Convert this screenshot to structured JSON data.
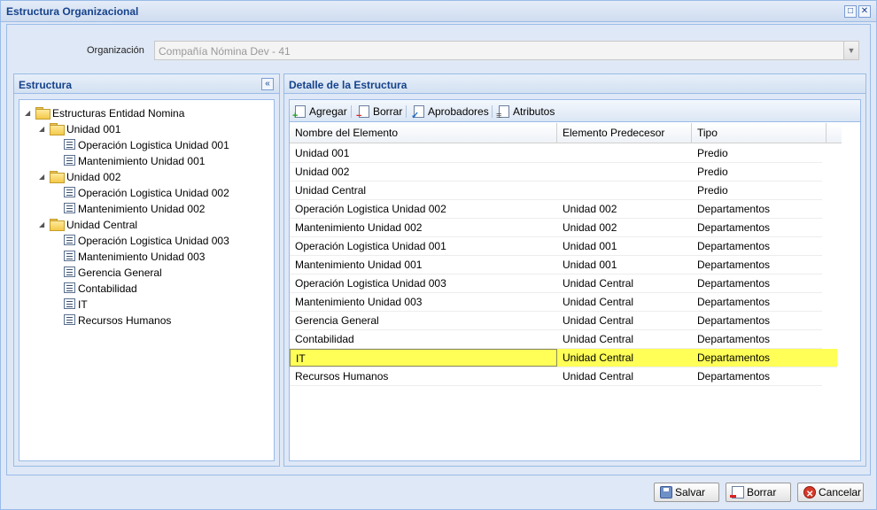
{
  "window": {
    "title": "Estructura Organizacional",
    "maximize_glyph": "□",
    "close_glyph": "✕"
  },
  "organization": {
    "label": "Organización",
    "value": "Compañía Nómina Dev - 41"
  },
  "left_panel": {
    "title": "Estructura",
    "collapse_glyph": "«",
    "tree": [
      {
        "label": "Estructuras Entidad Nomina",
        "level": 0,
        "type": "folder"
      },
      {
        "label": "Unidad 001",
        "level": 1,
        "type": "folder"
      },
      {
        "label": "Operación Logistica Unidad 001",
        "level": 2,
        "type": "leaf"
      },
      {
        "label": "Mantenimiento Unidad 001",
        "level": 2,
        "type": "leaf"
      },
      {
        "label": "Unidad 002",
        "level": 1,
        "type": "folder"
      },
      {
        "label": "Operación Logistica Unidad 002",
        "level": 2,
        "type": "leaf"
      },
      {
        "label": "Mantenimiento Unidad 002",
        "level": 2,
        "type": "leaf"
      },
      {
        "label": "Unidad Central",
        "level": 1,
        "type": "folder"
      },
      {
        "label": "Operación Logistica Unidad 003",
        "level": 2,
        "type": "leaf"
      },
      {
        "label": "Mantenimiento Unidad 003",
        "level": 2,
        "type": "leaf"
      },
      {
        "label": "Gerencia General",
        "level": 2,
        "type": "leaf"
      },
      {
        "label": "Contabilidad",
        "level": 2,
        "type": "leaf"
      },
      {
        "label": "IT",
        "level": 2,
        "type": "leaf"
      },
      {
        "label": "Recursos Humanos",
        "level": 2,
        "type": "leaf"
      }
    ]
  },
  "detail_panel": {
    "title": "Detalle de la Estructura",
    "toolbar": {
      "add_label": "Agregar",
      "delete_label": "Borrar",
      "approvers_label": "Aprobadores",
      "attributes_label": "Atributos"
    },
    "columns": [
      "Nombre del Elemento",
      "Elemento Predecesor",
      "Tipo"
    ],
    "rows": [
      {
        "name": "Unidad 001",
        "predecessor": "",
        "type": "Predio"
      },
      {
        "name": "Unidad 002",
        "predecessor": "",
        "type": "Predio"
      },
      {
        "name": "Unidad Central",
        "predecessor": "",
        "type": "Predio"
      },
      {
        "name": "Operación Logistica Unidad 002",
        "predecessor": "Unidad 002",
        "type": "Departamentos"
      },
      {
        "name": "Mantenimiento Unidad 002",
        "predecessor": "Unidad 002",
        "type": "Departamentos"
      },
      {
        "name": "Operación Logistica Unidad 001",
        "predecessor": "Unidad 001",
        "type": "Departamentos"
      },
      {
        "name": "Mantenimiento Unidad 001",
        "predecessor": "Unidad 001",
        "type": "Departamentos"
      },
      {
        "name": "Operación Logistica Unidad 003",
        "predecessor": "Unidad Central",
        "type": "Departamentos"
      },
      {
        "name": "Mantenimiento Unidad 003",
        "predecessor": "Unidad Central",
        "type": "Departamentos"
      },
      {
        "name": "Gerencia General",
        "predecessor": "Unidad Central",
        "type": "Departamentos"
      },
      {
        "name": "Contabilidad",
        "predecessor": "Unidad Central",
        "type": "Departamentos"
      },
      {
        "name": "IT",
        "predecessor": "Unidad Central",
        "type": "Departamentos",
        "selected": true
      },
      {
        "name": "Recursos Humanos",
        "predecessor": "Unidad Central",
        "type": "Departamentos"
      }
    ],
    "highlight_color": "#ffff57"
  },
  "footer": {
    "save_label": "Salvar",
    "delete_label": "Borrar",
    "cancel_label": "Cancelar"
  },
  "colors": {
    "accent_title": "#15428b",
    "panel_bg": "#dfe8f6",
    "border": "#99bbe8"
  }
}
